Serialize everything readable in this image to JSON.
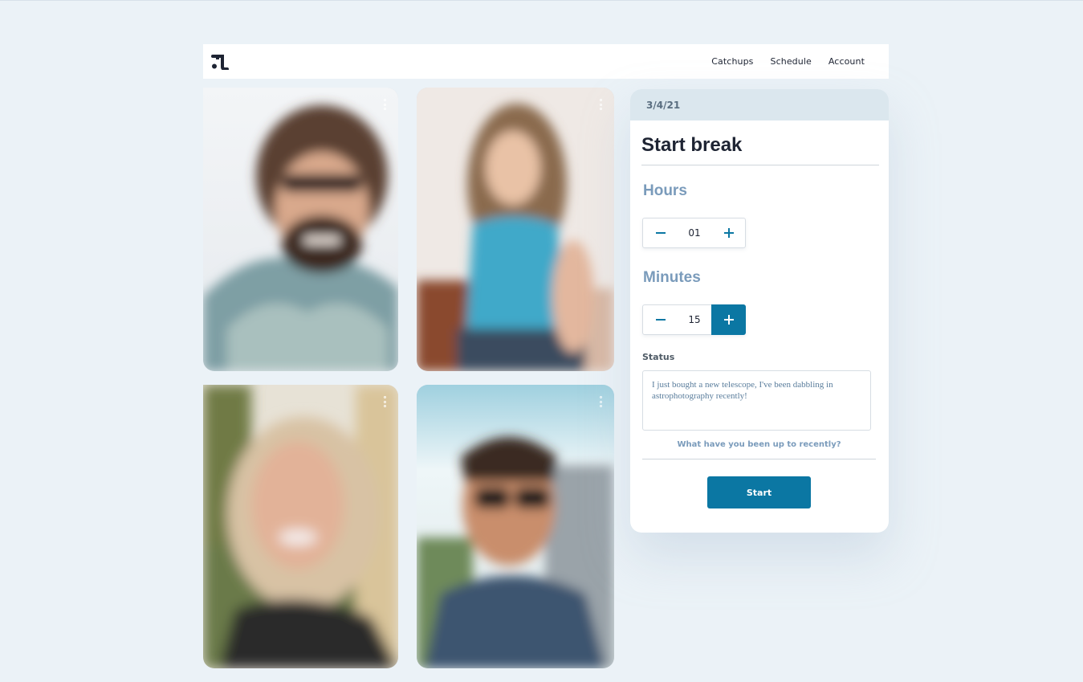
{
  "header": {
    "logo_icon": "logo-icon",
    "nav": [
      "Catchups",
      "Schedule",
      "Account"
    ]
  },
  "tiles": [
    {
      "menu_icon": "more-vertical-icon"
    },
    {
      "menu_icon": "more-vertical-icon"
    },
    {
      "menu_icon": "more-vertical-icon"
    },
    {
      "menu_icon": "more-vertical-icon"
    }
  ],
  "panel": {
    "date": "3/4/21",
    "title": "Start break",
    "hours": {
      "label": "Hours",
      "value": "01"
    },
    "minutes": {
      "label": "Minutes",
      "value": "15"
    },
    "status": {
      "label": "Status",
      "text": "I just bought a new telescope, I've been dabbling in astrophotography recently!",
      "hint": "What have you been up to recently?"
    },
    "start_label": "Start"
  },
  "colors": {
    "accent": "#0b77a3",
    "label_blue": "#7a9bbb",
    "background": "#ebf2f7"
  }
}
